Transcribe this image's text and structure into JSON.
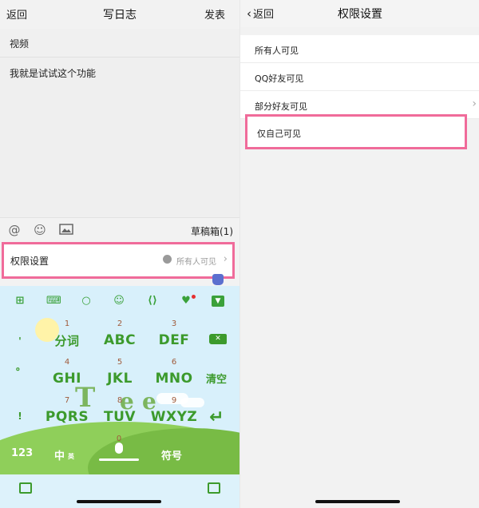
{
  "left": {
    "header": {
      "back": "返回",
      "title": "写日志",
      "publish": "发表"
    },
    "title_field": "视频",
    "body_text": "我就是试试这个功能",
    "toolbar": {
      "drafts": "草稿箱(1)"
    },
    "permission": {
      "label": "权限设置",
      "value": "所有人可见"
    },
    "keyboard": {
      "rows": [
        {
          "side": "'",
          "keys": [
            {
              "num": "1",
              "label": "分词"
            },
            {
              "num": "2",
              "label": "ABC"
            },
            {
              "num": "3",
              "label": "DEF"
            }
          ]
        },
        {
          "side": "。",
          "keys": [
            {
              "num": "4",
              "label": "GHI"
            },
            {
              "num": "5",
              "label": "JKL"
            },
            {
              "num": "6",
              "label": "MNO"
            }
          ]
        },
        {
          "side": "!",
          "keys": [
            {
              "num": "7",
              "label": "PQRS"
            },
            {
              "num": "8",
              "label": "TUV"
            },
            {
              "num": "9",
              "label": "WXYZ"
            }
          ]
        }
      ],
      "clear": "清空",
      "bottom": {
        "num_key": "123",
        "lang_key": "中",
        "lang_sub": "英",
        "zero": "0",
        "symbols": "符号"
      }
    }
  },
  "right": {
    "header": {
      "back": "返回",
      "title": "权限设置"
    },
    "options": [
      {
        "label": "所有人可见"
      },
      {
        "label": "QQ好友可见"
      },
      {
        "label": "部分好友可见"
      }
    ],
    "selected_option": "仅自己可见"
  },
  "colors": {
    "highlight": "#f06b9a",
    "keyboard_green": "#3c9a2c",
    "keyboard_bg": "#d8f0fb"
  }
}
